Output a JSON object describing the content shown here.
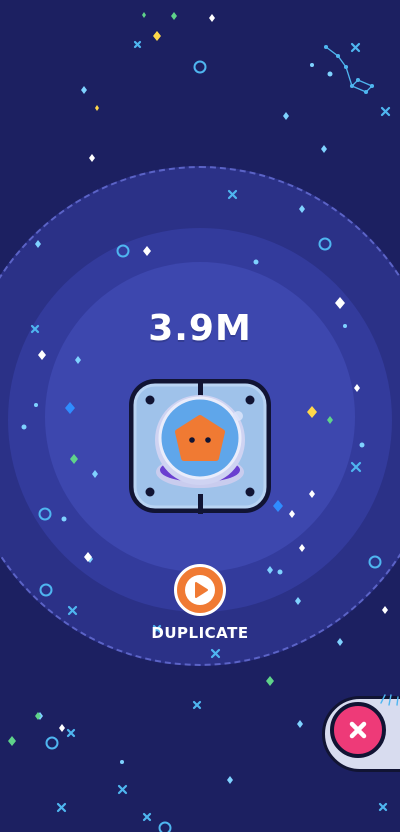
{
  "counter": {
    "value": "3.9M"
  },
  "machine": {
    "icon": "duplicator-machine-icon",
    "creature": "orange-pentagon-creature-icon"
  },
  "duplicate": {
    "label": "DUPLICATE",
    "icon": "play-icon"
  },
  "close": {
    "icon": "close-icon"
  },
  "colors": {
    "background": "#1c2061",
    "ring_outer": "#2b3187",
    "ring_mid": "#333b9c",
    "ring_inner": "#3d47ae",
    "accent_orange": "#f07a33",
    "close_pink": "#ee3a78"
  }
}
